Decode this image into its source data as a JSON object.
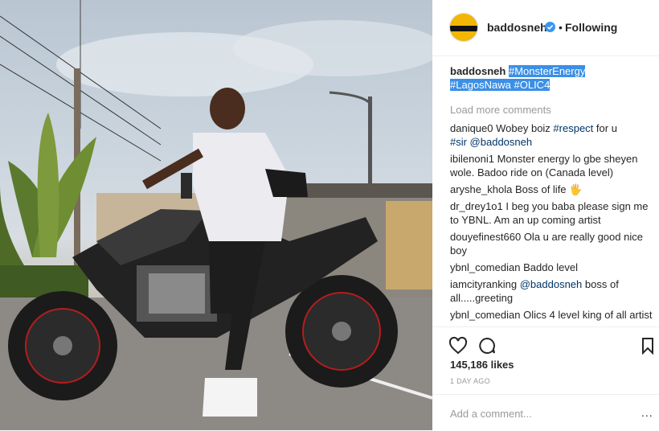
{
  "post": {
    "username": "baddosneh",
    "follow_status": "Following",
    "caption_user": "baddosneh",
    "caption_tags": [
      "#MonsterEnergy",
      "#LagosNawa #OLIC4"
    ],
    "load_more": "Load more comments",
    "comments": [
      {
        "user": "danique0",
        "text": "Wobey boiz ",
        "tag1": "#respect",
        "mid": " for u ",
        "tail": "#sir @baddosneh"
      },
      {
        "user": "ibilenoni1",
        "text": "Monster energy lo gbe sheyen wole. Badoo ride on (Canada level)"
      },
      {
        "user": "aryshe_khola",
        "text": "Boss of life 🖐"
      },
      {
        "user": "dr_drey1o1",
        "text": "I beg you baba please sign me to YBNL. Am an up coming artist"
      },
      {
        "user": "douyefinest660",
        "text": "Ola u are really good nice boy"
      },
      {
        "user": "ybnl_comedian",
        "text": "Baddo level"
      },
      {
        "user": "iamcityranking",
        "mention": "@baddosneh",
        "text": "boss of all.....greeting"
      },
      {
        "user": "ybnl_comedian",
        "text": "Olics 4 level king of all artist"
      }
    ],
    "likes": "145,186 likes",
    "time_ago": "1 DAY AGO",
    "add_comment_placeholder": "Add a comment...",
    "more_options": "..."
  },
  "colors": {
    "accent": "#3b8fe6",
    "verified": "#3897f0",
    "hashtag": "#003569"
  },
  "icons": [
    "verified-badge-icon",
    "heart-icon",
    "comment-icon",
    "bookmark-icon"
  ]
}
